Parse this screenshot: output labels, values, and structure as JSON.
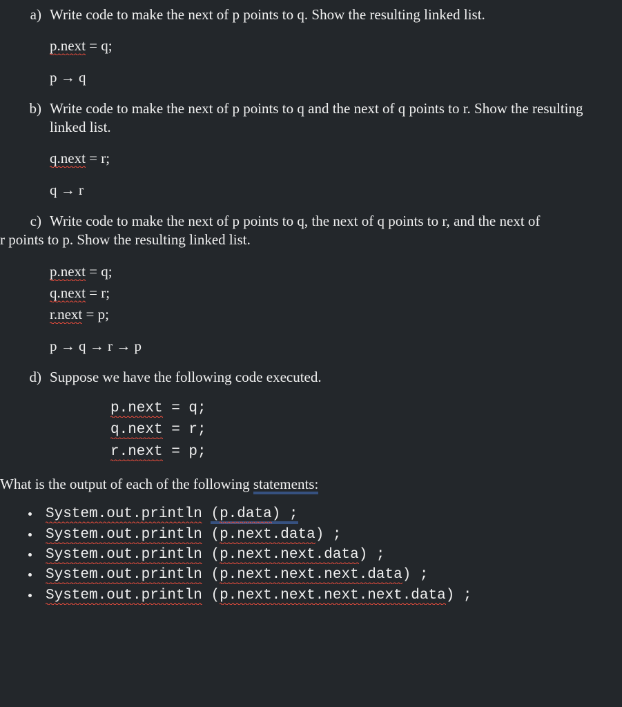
{
  "a": {
    "label": "a)",
    "question": "Write code to make the next of p points to q. Show the resulting linked list.",
    "code": "p.next",
    "code_rest": " = q;",
    "result_p": "p ",
    "result_q": " q"
  },
  "b": {
    "label": "b)",
    "question": "Write code to make the next of p points to q and the next of q points to r. Show the resulting linked list.",
    "code": "q.next",
    "code_rest": " = r;",
    "result_q": "q ",
    "result_r": " r"
  },
  "c": {
    "label": "c)",
    "question_1": "Write code to make the next of p points to q, the next of q points to r, and the next of ",
    "question_2": "r points to p. Show the resulting linked list.",
    "code1": "p.next",
    "code1_rest": " = q;",
    "code2": "q.next",
    "code2_rest": " = r;",
    "code3": "r.next",
    "code3_rest": " = p;",
    "result_p": "p ",
    "result_q": " q ",
    "result_r": " r ",
    "result_p2": " p"
  },
  "d": {
    "label": "d)",
    "question": "Suppose we have the following code executed.",
    "code1a": "p.next",
    "code1b": "  =  q;",
    "code2a": "q.next",
    "code2b": "  =  r;",
    "code3a": "r.next",
    "code3b": "  =  p;",
    "output_prompt_1": "What is the output of each of the following ",
    "output_prompt_2": "statements:",
    "out": {
      "sys": "System.out.println",
      "sp": " ",
      "l1a": "(",
      "l1b": "p.data",
      "l1c": ") ;",
      "l2a": "(",
      "l2b": "p.next.data",
      "l2c": ") ;",
      "l3a": "(",
      "l3b": "p.next.next.data",
      "l3c": ") ;",
      "l4a": "(",
      "l4b": "p.next.next.next.data",
      "l4c": ") ;",
      "l5a": "(",
      "l5b": "p.next.next.next.next.data",
      "l5c": ") ;"
    }
  },
  "arrow": "→"
}
